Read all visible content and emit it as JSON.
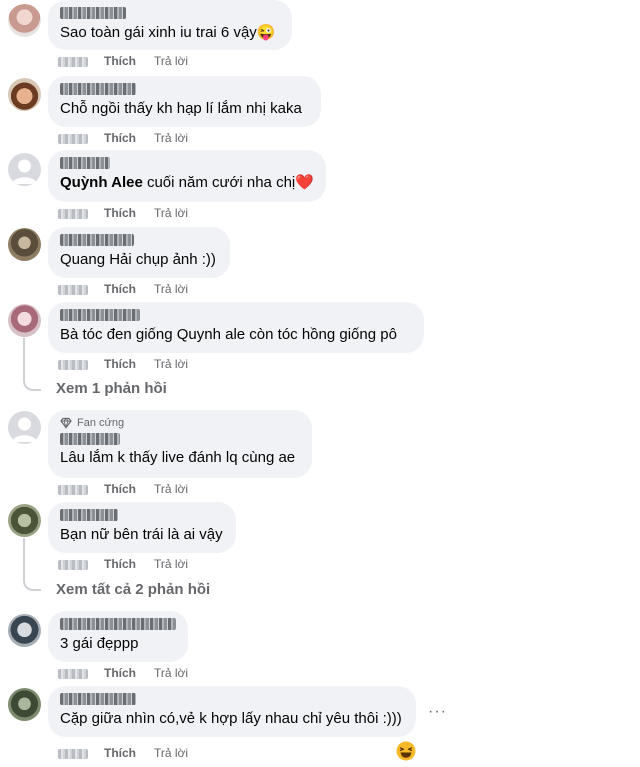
{
  "comments": [
    {
      "author": "Huyền My",
      "text": "Sao toàn gái xinh iu trai 6 vậy",
      "emoji": "😜",
      "like": "Thích",
      "reply": "Trả lời"
    },
    {
      "author": "Hoàng Anh",
      "text": "Chỗ ngồi thấy kh hạp lí lắm nhị kaka",
      "like": "Thích",
      "reply": "Trả lời"
    },
    {
      "author": "Linh Lê",
      "mention": "Quỳnh Alee",
      "text": " cuối năm cưới nha chị",
      "emoji": "❤️",
      "like": "Thích",
      "reply": "Trả lời"
    },
    {
      "author": "Ngọc Trang",
      "text": "Quang Hải chụp ảnh :))",
      "like": "Thích",
      "reply": "Trả lời"
    },
    {
      "author": "Minh Thư",
      "text": "Bà tóc đen giống Quynh ale còn tóc hồng giống pô",
      "like": "Thích",
      "reply": "Trả lời",
      "view_replies": "Xem 1 phản hồi"
    },
    {
      "badge": "Fan cứng",
      "author": "Tuấn Kiệt",
      "text": "Lâu lắm k thấy live đánh lq cùng ae",
      "like": "Thích",
      "reply": "Trả lời"
    },
    {
      "author": "Thiên Bảo",
      "text": "Bạn nữ bên trái là ai vậy",
      "like": "Thích",
      "reply": "Trả lời",
      "view_replies": "Xem tất cả 2 phản hồi"
    },
    {
      "author": "Anh Khoa",
      "text": "3 gái đẹppp",
      "like": "Thích",
      "reply": "Trả lời"
    },
    {
      "author": "Hải Nam",
      "text": "Cặp giữa nhìn có,vẻ k hợp lấy nhau chỉ yêu thôi :)))",
      "like": "Thích",
      "reply": "Trả lời",
      "more": "···"
    }
  ],
  "colors": {
    "bubble": "#f0f2f5",
    "muted": "#65676b",
    "heart": "#e41e3f"
  },
  "icons": {
    "fan_badge": "diamond-icon",
    "reaction": "grinning-squinting-face-icon"
  }
}
